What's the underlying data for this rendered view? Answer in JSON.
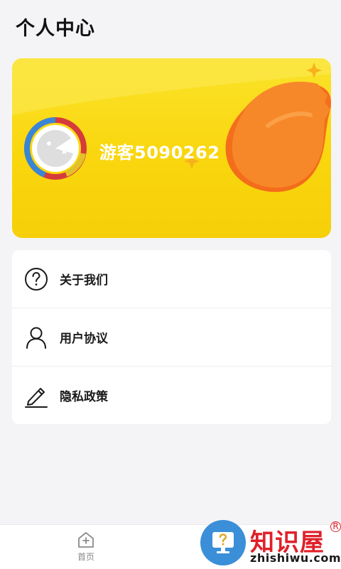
{
  "header": {
    "title": "个人中心"
  },
  "profile": {
    "username": "游客5090262",
    "avatar_icon": "guest-avatar-icon"
  },
  "menu": {
    "items": [
      {
        "label": "关于我们",
        "icon": "question-circle-icon"
      },
      {
        "label": "用户协议",
        "icon": "user-icon"
      },
      {
        "label": "隐私政策",
        "icon": "pen-icon"
      }
    ]
  },
  "bottom_nav": {
    "items": [
      {
        "label": "首页",
        "icon": "home-icon"
      }
    ]
  },
  "watermark": {
    "brand": "知识屋",
    "domain": "zhishiwu.com",
    "registered": "R"
  },
  "colors": {
    "card_yellow": "#f9d60e",
    "accent_orange": "#f7882a",
    "watermark_blue": "#3a8fd8",
    "watermark_red": "#e0202a"
  }
}
